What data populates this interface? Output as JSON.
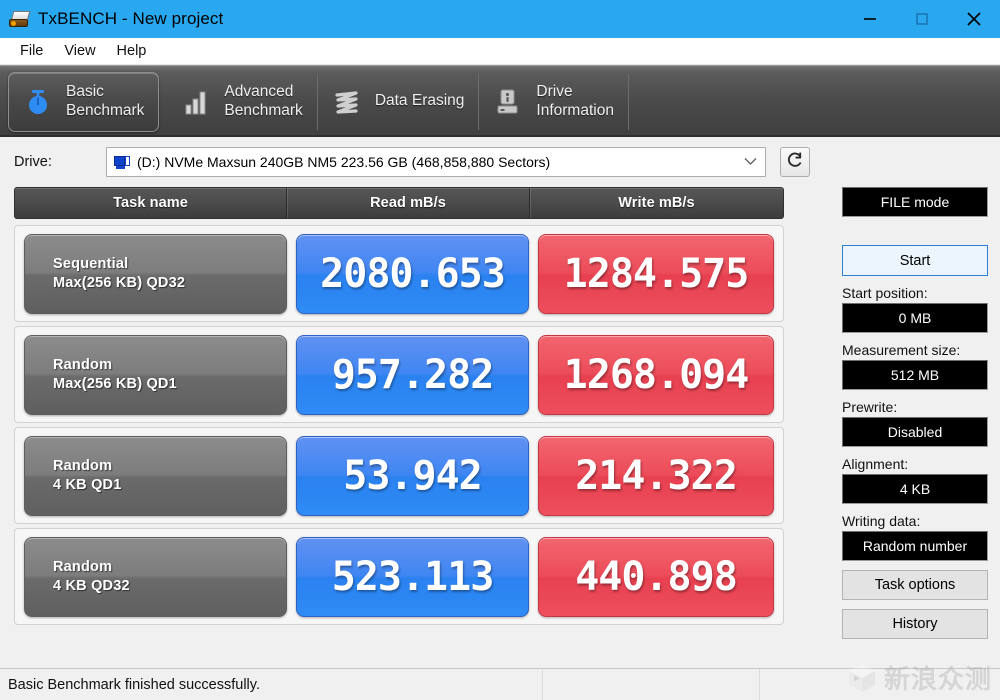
{
  "window": {
    "title": "TxBENCH - New project",
    "app_icon": "drive-icon",
    "accent_color": "#29a8f0",
    "minimize_label": "Minimize",
    "maximize_label": "Maximize",
    "close_label": "Close"
  },
  "menubar": {
    "items": [
      {
        "label": "File"
      },
      {
        "label": "View"
      },
      {
        "label": "Help"
      }
    ]
  },
  "tabs": [
    {
      "label": "Basic\nBenchmark",
      "icon": "stopwatch-icon",
      "active": true
    },
    {
      "label": "Advanced\nBenchmark",
      "icon": "bar-chart-icon",
      "active": false
    },
    {
      "label": "Data Erasing",
      "icon": "eraser-waves-icon",
      "active": false
    },
    {
      "label": "Drive\nInformation",
      "icon": "drive-info-icon",
      "active": false
    }
  ],
  "drive_row": {
    "label": "Drive:",
    "selected": "(D:) NVMe Maxsun 240GB NM5  223.56 GB (468,858,880 Sectors)",
    "dropdown_icon": "chevron-down-icon",
    "refresh_icon": "refresh-icon"
  },
  "table": {
    "headers": {
      "task": "Task name",
      "read": "Read mB/s",
      "write": "Write mB/s"
    },
    "read_color": "#2f86f2",
    "write_color": "#ec4c59",
    "rows": [
      {
        "task_line1": "Sequential",
        "task_line2": "Max(256 KB) QD32",
        "read": "2080.653",
        "write": "1284.575"
      },
      {
        "task_line1": "Random",
        "task_line2": "Max(256 KB) QD1",
        "read": "957.282",
        "write": "1268.094"
      },
      {
        "task_line1": "Random",
        "task_line2": "4 KB QD1",
        "read": "53.942",
        "write": "214.322"
      },
      {
        "task_line1": "Random",
        "task_line2": "4 KB QD32",
        "read": "523.113",
        "write": "440.898"
      }
    ]
  },
  "side_panel": {
    "mode_button": "FILE mode",
    "start_button": "Start",
    "start_position_label": "Start position:",
    "start_position_value": "0 MB",
    "measurement_size_label": "Measurement size:",
    "measurement_size_value": "512 MB",
    "prewrite_label": "Prewrite:",
    "prewrite_value": "Disabled",
    "alignment_label": "Alignment:",
    "alignment_value": "4 KB",
    "writing_data_label": "Writing data:",
    "writing_data_value": "Random number",
    "task_options_button": "Task options",
    "history_button": "History"
  },
  "statusbar": {
    "message": "Basic Benchmark finished successfully.",
    "segment2": "",
    "segment3": ""
  },
  "watermark": {
    "text": "新浪众测"
  }
}
